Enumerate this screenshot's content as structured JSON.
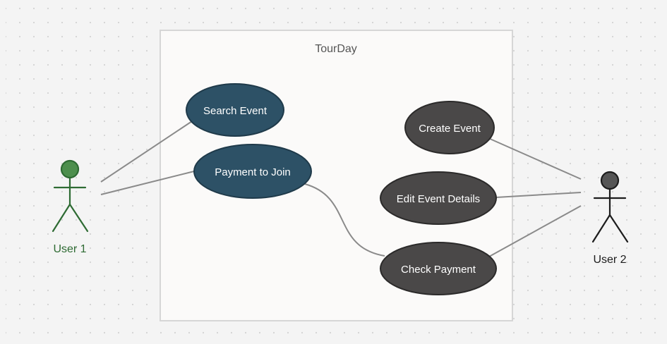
{
  "system": {
    "title": "TourDay"
  },
  "actors": [
    {
      "id": "user1",
      "label": "User 1",
      "color": "#2e6b33",
      "head_fill": "#4d8f4d"
    },
    {
      "id": "user2",
      "label": "User 2",
      "color": "#1c1c1c",
      "head_fill": "#555555"
    }
  ],
  "use_cases": [
    {
      "id": "search-event",
      "label": "Search Event",
      "fill": "#2d5166",
      "stroke": "#1f3a4a"
    },
    {
      "id": "payment-to-join",
      "label": "Payment to Join",
      "fill": "#2d5166",
      "stroke": "#1f3a4a"
    },
    {
      "id": "create-event",
      "label": "Create Event",
      "fill": "#4a4848",
      "stroke": "#2b2a2a"
    },
    {
      "id": "edit-event-details",
      "label": "Edit Event Details",
      "fill": "#4a4848",
      "stroke": "#2b2a2a"
    },
    {
      "id": "check-payment",
      "label": "Check Payment",
      "fill": "#4a4848",
      "stroke": "#2b2a2a"
    }
  ],
  "associations": [
    {
      "from": "user1",
      "to": "search-event"
    },
    {
      "from": "user1",
      "to": "payment-to-join"
    },
    {
      "from": "payment-to-join",
      "to": "check-payment"
    },
    {
      "from": "user2",
      "to": "create-event"
    },
    {
      "from": "user2",
      "to": "edit-event-details"
    },
    {
      "from": "user2",
      "to": "check-payment"
    }
  ],
  "colors": {
    "background": "#f4f4f4",
    "grid_dot": "#d3d3d3",
    "system_fill": "#fbfaf9",
    "system_stroke": "#d6d6d6",
    "line": "#8a8a8a",
    "use_case_text": "#ffffff",
    "system_title": "#555555"
  }
}
